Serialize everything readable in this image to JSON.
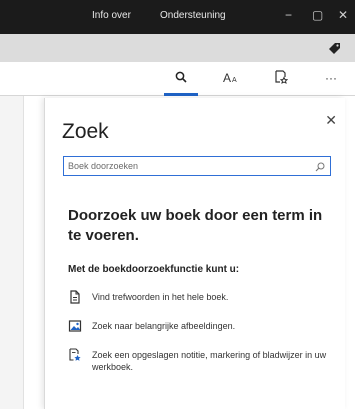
{
  "titlebar": {
    "menu_info": "Info over",
    "menu_support": "Ondersteuning",
    "minimize": "−",
    "maximize": "▢",
    "close": "✕"
  },
  "toolbar": {
    "search_icon": "search-icon",
    "font_icon": "font-size-icon",
    "bookmark_icon": "bookmark-icon",
    "more": "···"
  },
  "panel": {
    "title": "Zoek",
    "close": "✕",
    "search_placeholder": "Boek doorzoeken",
    "headline": "Doorzoek uw boek door een term in te voeren.",
    "intro": "Met de boekdoorzoekfunctie kunt u:",
    "features": [
      {
        "icon": "document-icon",
        "text": "Vind trefwoorden in het hele boek."
      },
      {
        "icon": "image-icon",
        "text": "Zoek naar belangrijke afbeeldingen."
      },
      {
        "icon": "note-star-icon",
        "text": "Zoek een opgeslagen notitie, markering of bladwijzer in uw werkboek."
      }
    ]
  },
  "colors": {
    "accent": "#1f63c6",
    "titlebar": "#1b1b1b"
  }
}
